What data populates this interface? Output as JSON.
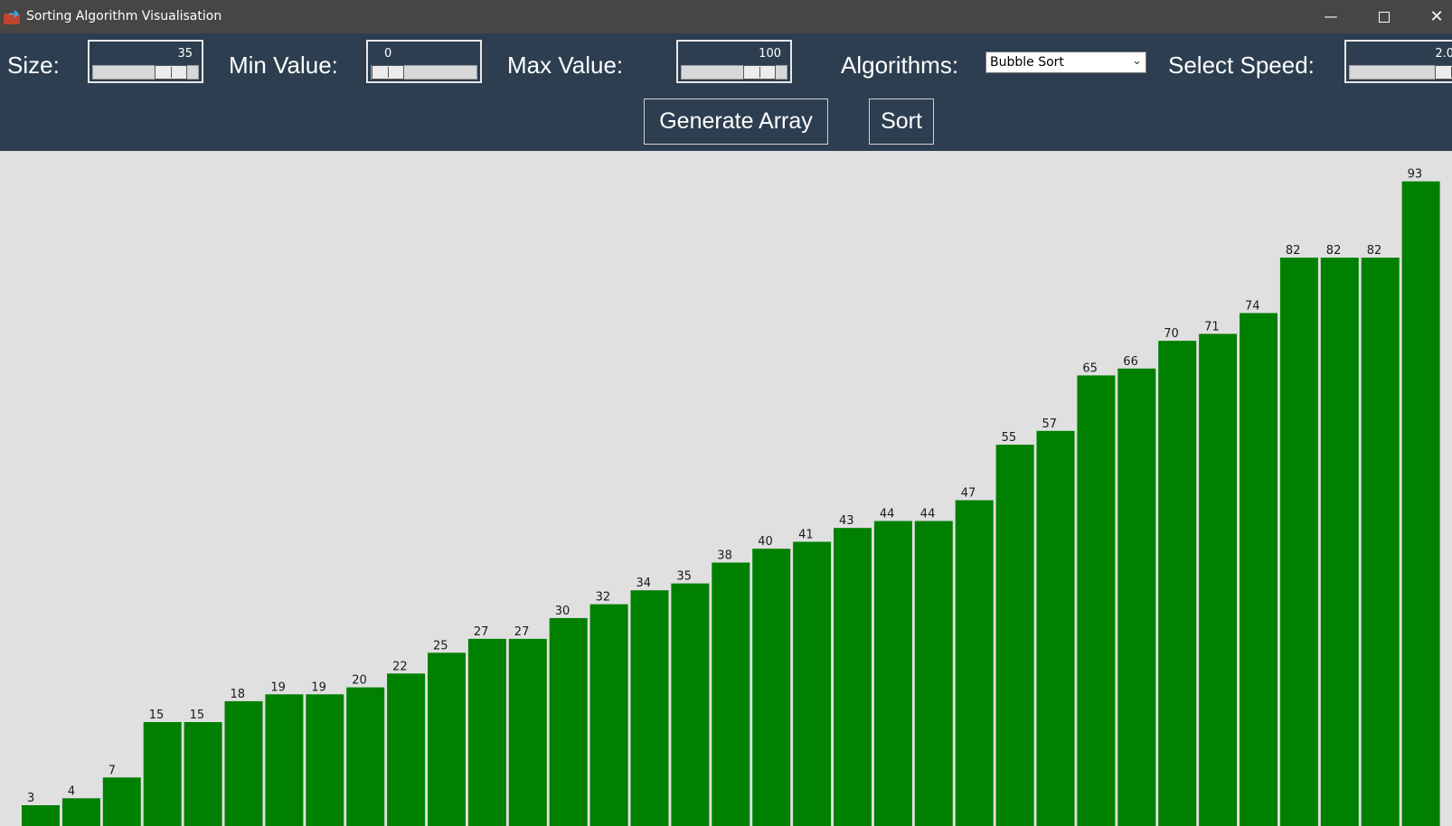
{
  "window": {
    "title": "Sorting Algorithm Visualisation",
    "minimize_icon": "minimize-icon",
    "maximize_icon": "maximize-icon",
    "close_icon": "close-icon"
  },
  "controls": {
    "size_label": "Size:",
    "size_value": "35",
    "size_fraction": 0.85,
    "min_label": "Min Value:",
    "min_value": "0",
    "min_fraction": 0.0,
    "max_label": "Max Value:",
    "max_value": "100",
    "max_fraction": 0.85,
    "algorithms_label": "Algorithms:",
    "algorithm_selected": "Bubble Sort",
    "speed_label": "Select Speed:",
    "speed_value": "2.0",
    "generate_button": "Generate Array",
    "sort_button": "Sort"
  },
  "colors": {
    "panel_bg": "#2c3e50",
    "bar_fill": "#008000",
    "chart_bg": "#e0e0e0"
  },
  "chart_data": {
    "type": "bar",
    "title": "",
    "xlabel": "",
    "ylabel": "",
    "grid": false,
    "values": [
      3,
      4,
      7,
      15,
      15,
      18,
      19,
      19,
      20,
      22,
      25,
      27,
      27,
      30,
      32,
      34,
      35,
      38,
      40,
      41,
      43,
      44,
      44,
      47,
      55,
      57,
      65,
      66,
      70,
      71,
      74,
      82,
      82,
      82,
      93
    ]
  }
}
